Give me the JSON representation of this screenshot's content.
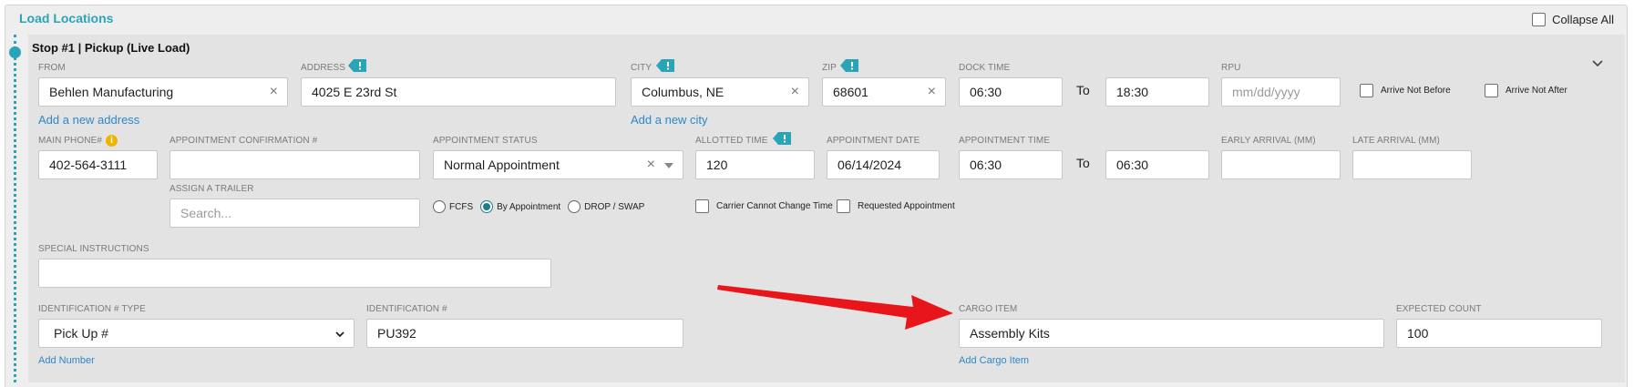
{
  "section": {
    "title": "Load Locations",
    "collapse_all_label": "Collapse All"
  },
  "stop": {
    "title": "Stop #1 | Pickup (Live Load)"
  },
  "row1": {
    "from_label": "FROM",
    "from_value": "Behlen Manufacturing",
    "add_address_link": "Add a new address",
    "address_label": "ADDRESS",
    "address_value": "4025 E 23rd St",
    "city_label": "CITY",
    "city_value": "Columbus, NE",
    "add_city_link": "Add a new city",
    "zip_label": "ZIP",
    "zip_value": "68601",
    "dock_time_label": "DOCK TIME",
    "dock_time_from": "06:30",
    "to_label": "To",
    "dock_time_to": "18:30",
    "rpu_label": "RPU",
    "rpu_placeholder": "mm/dd/yyyy",
    "arrive_not_before": "Arrive Not Before",
    "arrive_not_after": "Arrive Not After"
  },
  "row2": {
    "phone_label": "MAIN PHONE#",
    "phone_value": "402-564-3111",
    "appt_conf_label": "APPOINTMENT CONFIRMATION #",
    "appt_conf_value": "",
    "appt_status_label": "APPOINTMENT STATUS",
    "appt_status_value": "Normal Appointment",
    "allotted_time_label": "ALLOTTED TIME",
    "allotted_time_value": "120",
    "appt_date_label": "APPOINTMENT DATE",
    "appt_date_value": "06/14/2024",
    "appt_time_label": "APPOINTMENT TIME",
    "appt_time_from": "06:30",
    "to_label": "To",
    "appt_time_to": "06:30",
    "early_arrival_label": "EARLY ARRIVAL (MM)",
    "early_arrival_value": "",
    "late_arrival_label": "LATE ARRIVAL (MM)",
    "late_arrival_value": ""
  },
  "row3": {
    "trailer_label": "ASSIGN A TRAILER",
    "trailer_placeholder": "Search...",
    "radio_fcfs": "FCFS",
    "radio_by_appointment": "By Appointment",
    "radio_drop_swap": "DROP / SWAP",
    "carrier_cannot_change": "Carrier Cannot Change Time",
    "requested_appointment": "Requested Appointment"
  },
  "row4": {
    "special_instructions_label": "SPECIAL INSTRUCTIONS",
    "special_instructions_value": ""
  },
  "row5": {
    "id_type_label": "IDENTIFICATION # TYPE",
    "id_type_value": "Pick Up #",
    "add_number_link": "Add Number",
    "id_number_label": "IDENTIFICATION #",
    "id_number_value": "PU392",
    "cargo_item_label": "CARGO ITEM",
    "cargo_item_value": "Assembly Kits",
    "add_cargo_link": "Add Cargo Item",
    "expected_count_label": "EXPECTED COUNT",
    "expected_count_value": "100"
  },
  "colors": {
    "accent": "#2aa5b8",
    "link": "#2d87c9",
    "annotation_arrow": "#e8161b",
    "info_badge": "#f0b400"
  },
  "icons": [
    "tag-info-icon",
    "clear-icon",
    "dropdown-caret-icon",
    "chevron-down-icon",
    "info-icon",
    "annotation-arrow"
  ]
}
